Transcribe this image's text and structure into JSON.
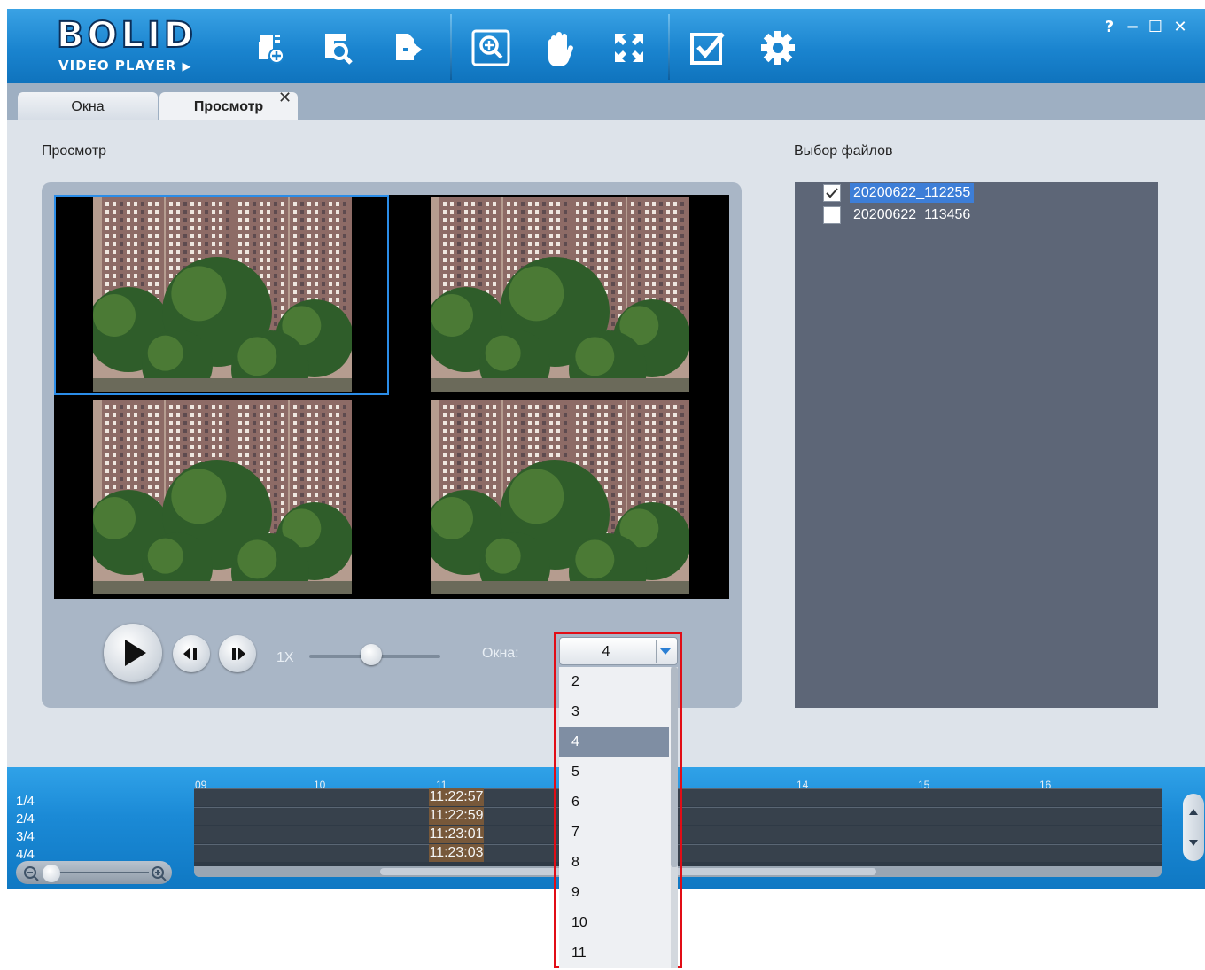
{
  "app": {
    "logo_word": "BOLID",
    "logo_sub": "VIDEO PLAYER"
  },
  "toolbar": {
    "icons": [
      "open-file-icon",
      "search-file-icon",
      "export-icon",
      "zoom-icon",
      "pan-hand-icon",
      "fullscreen-icon",
      "check-icon",
      "settings-icon"
    ]
  },
  "window_controls": {
    "help": "?",
    "minimize": "−",
    "maximize": "☐",
    "close": "✕"
  },
  "tabs": [
    {
      "label": "Окна"
    },
    {
      "label": "Просмотр",
      "active": true
    }
  ],
  "tab_close": "✕",
  "preview": {
    "title": "Просмотр",
    "speed_label": "1X",
    "windows_label": "Окна:"
  },
  "files": {
    "title": "Выбор файлов",
    "items": [
      {
        "name": "20200622_112255",
        "checked": true
      },
      {
        "name": "20200622_113456",
        "checked": false
      }
    ]
  },
  "timeline": {
    "rows": [
      "1/4",
      "2/4",
      "3/4",
      "4/4"
    ],
    "ticks": [
      "09",
      "10",
      "11",
      "14",
      "15",
      "16"
    ],
    "time_tags": [
      "11:22:57",
      "11:22:59",
      "11:23:01",
      "11:23:03"
    ]
  },
  "windows_select": {
    "value": "4",
    "options": [
      "2",
      "3",
      "4",
      "5",
      "6",
      "7",
      "8",
      "9",
      "10",
      "11"
    ],
    "selected_index": 2
  },
  "colors": {
    "toolbar": "#1a84cf",
    "highlight": "#e10d16",
    "selection": "#3d7ed7"
  }
}
